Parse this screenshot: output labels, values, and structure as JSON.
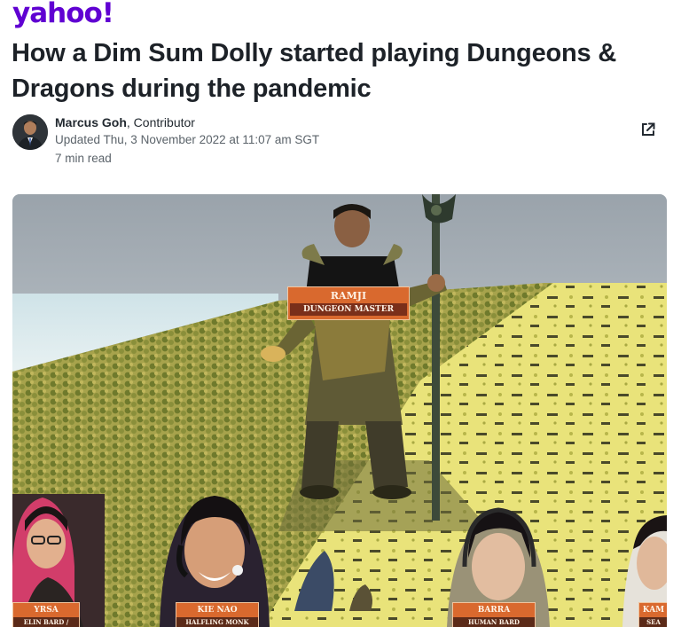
{
  "header": {
    "logo_text": "yahoo!"
  },
  "article": {
    "headline": "How a Dim Sum Dolly started playing Dungeons & Dragons during the pandemic",
    "author_name": "Marcus Goh",
    "author_role": ", Contributor",
    "updated": "Updated Thu, 3 November 2022 at 11:07 am SGT",
    "read_time": "7 min read"
  },
  "hero": {
    "main_tag": {
      "name": "RAMJI",
      "role": "DUNGEON MASTER"
    },
    "player_tags": [
      {
        "name": "YRSA",
        "role": "ELIN BARD / FIGHTER"
      },
      {
        "name": "KIE NAO",
        "role": "HALFLING MONK"
      },
      {
        "name": "BARRA",
        "role": "HUMAN BARD"
      },
      {
        "name": "KAM",
        "role": "SEA"
      }
    ]
  },
  "colors": {
    "brand": "#6001d2",
    "accent_tag": "#d9692e"
  },
  "icons": {
    "share": "share-external-icon"
  }
}
